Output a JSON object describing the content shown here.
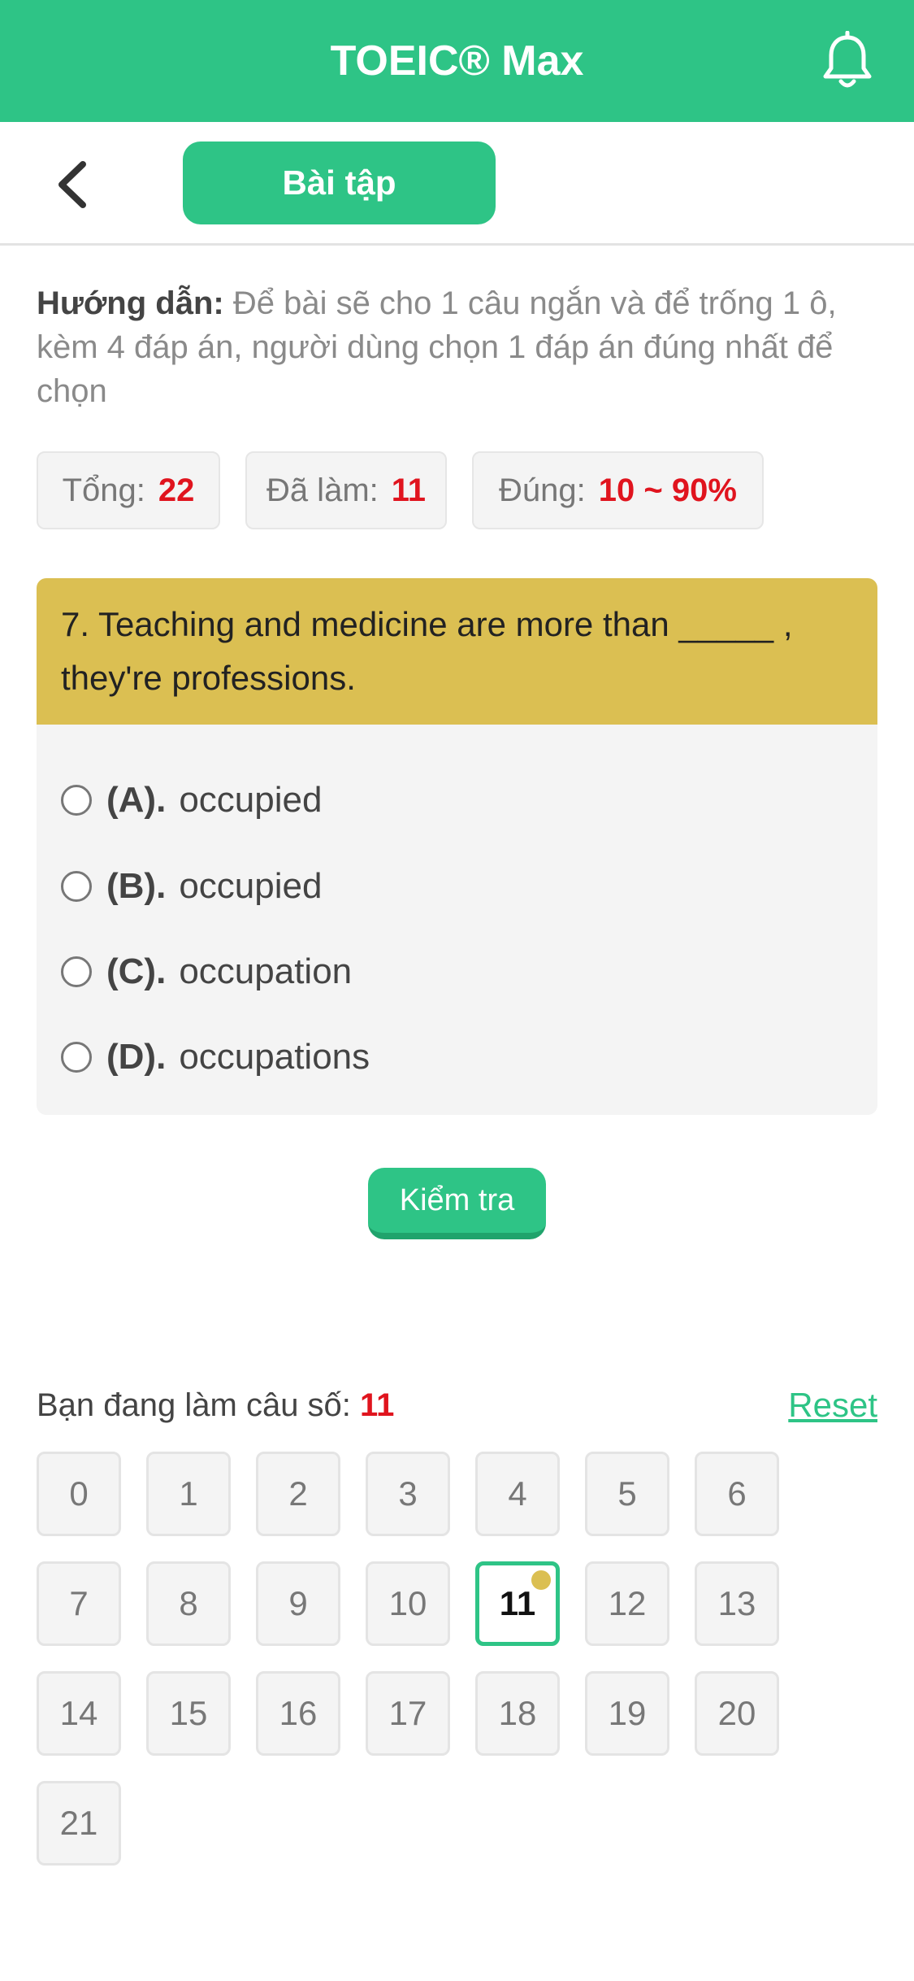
{
  "header": {
    "title": "TOEIC® Max"
  },
  "nav": {
    "tab_label": "Bài tập"
  },
  "guide": {
    "label": "Hướng dẫn:",
    "text": "Để bài sẽ cho 1 câu ngắn và để trống 1 ô, kèm 4 đáp án, người dùng chọn 1 đáp án đúng nhất để chọn"
  },
  "stats": {
    "total_label": "Tổng:",
    "total_value": "22",
    "done_label": "Đã làm:",
    "done_value": "11",
    "correct_label": "Đúng:",
    "correct_value": "10 ~ 90%"
  },
  "question": {
    "text": "7. Teaching and medicine are more than _____ , they're professions.",
    "options": [
      {
        "letter": "(A).",
        "text": "occupied"
      },
      {
        "letter": "(B).",
        "text": "occupied"
      },
      {
        "letter": "(C).",
        "text": "occupation"
      },
      {
        "letter": "(D).",
        "text": "occupations"
      }
    ]
  },
  "check_label": "Kiểm tra",
  "progress": {
    "label": "Bạn đang làm câu số:",
    "current": "11",
    "reset_label": "Reset"
  },
  "question_numbers": [
    "0",
    "1",
    "2",
    "3",
    "4",
    "5",
    "6",
    "7",
    "8",
    "9",
    "10",
    "11",
    "12",
    "13",
    "14",
    "15",
    "16",
    "17",
    "18",
    "19",
    "20",
    "21"
  ],
  "colors": {
    "brand": "#2ec486",
    "question_header": "#dbbf52",
    "highlight": "#e0141e"
  },
  "icons": {
    "notification": "bell-icon",
    "back": "chevron-left-icon"
  }
}
